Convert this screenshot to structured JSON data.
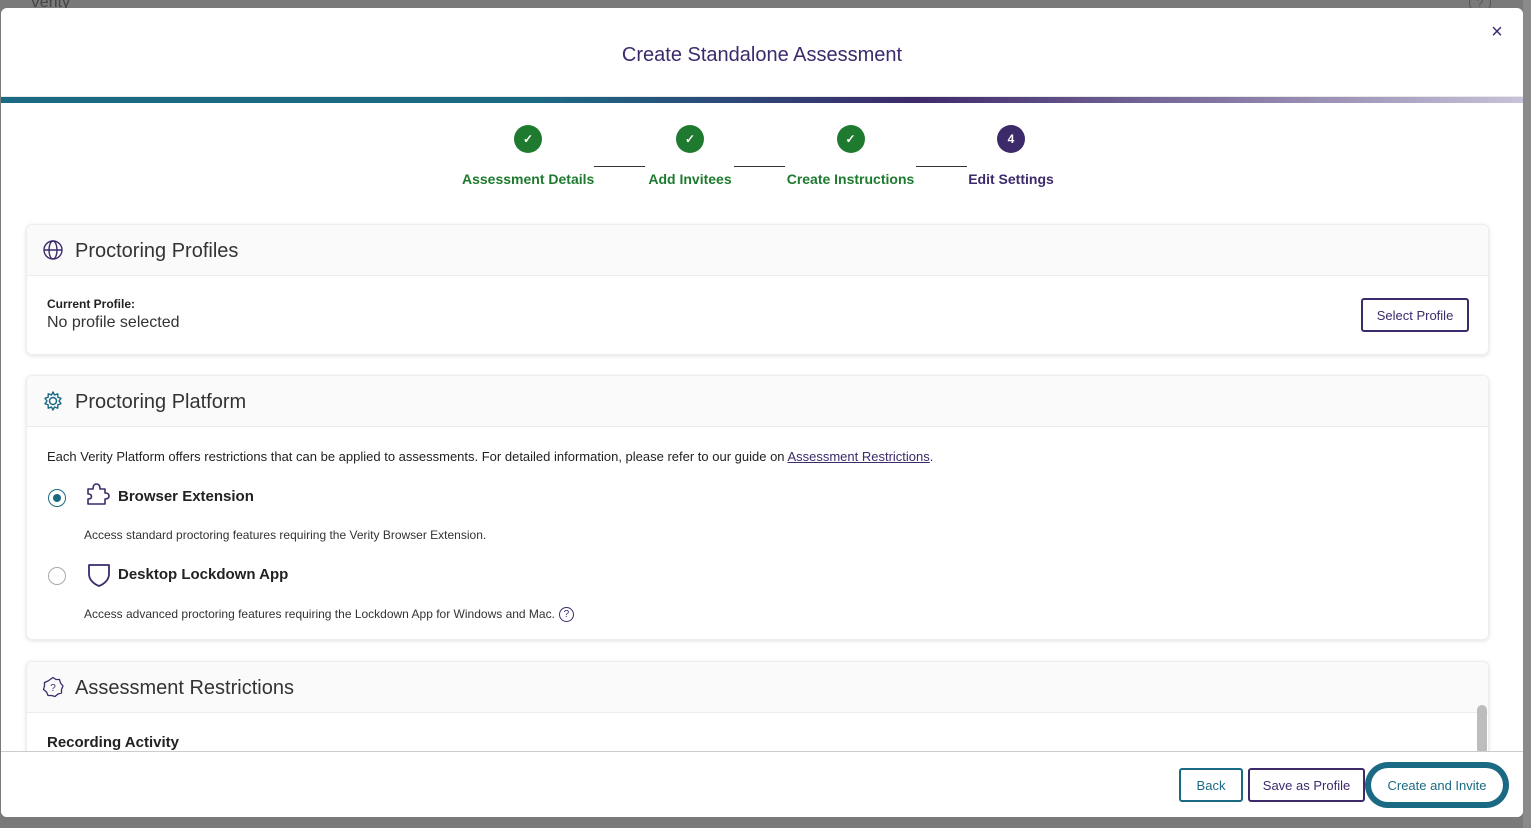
{
  "background": {
    "app_name": "Verity",
    "help": "?"
  },
  "modal": {
    "title": "Create Standalone Assessment",
    "close": "×"
  },
  "stepper": {
    "steps": [
      {
        "label": "Assessment Details",
        "state": "done",
        "marker": "✓"
      },
      {
        "label": "Add Invitees",
        "state": "done",
        "marker": "✓"
      },
      {
        "label": "Create Instructions",
        "state": "done",
        "marker": "✓"
      },
      {
        "label": "Edit Settings",
        "state": "current",
        "marker": "4"
      }
    ]
  },
  "proctoring_profiles": {
    "title": "Proctoring Profiles",
    "icon": "globe-icon",
    "current_label": "Current Profile:",
    "current_value": "No profile selected",
    "select_button": "Select Profile"
  },
  "proctoring_platform": {
    "title": "Proctoring Platform",
    "icon": "gear-icon",
    "description_prefix": "Each Verity Platform offers restrictions that can be applied to assessments. For detailed information, please refer to our guide on ",
    "description_link": "Assessment Restrictions",
    "description_suffix": ".",
    "options": [
      {
        "title": "Browser Extension",
        "icon": "puzzle-piece-icon",
        "description": "Access standard proctoring features requiring the Verity Browser Extension.",
        "selected": true
      },
      {
        "title": "Desktop Lockdown App",
        "icon": "shield-icon",
        "description": "Access advanced proctoring features requiring the Lockdown App for Windows and Mac.",
        "selected": false,
        "help": "?"
      }
    ]
  },
  "assessment_restrictions": {
    "title": "Assessment Restrictions",
    "icon": "question-badge-icon",
    "section_label": "Recording Activity"
  },
  "footer": {
    "back": "Back",
    "save_profile": "Save as Profile",
    "create_invite": "Create and Invite"
  },
  "colors": {
    "primary_purple": "#3d2a6b",
    "teal": "#1b6a84",
    "success_green": "#1e7a2e"
  }
}
